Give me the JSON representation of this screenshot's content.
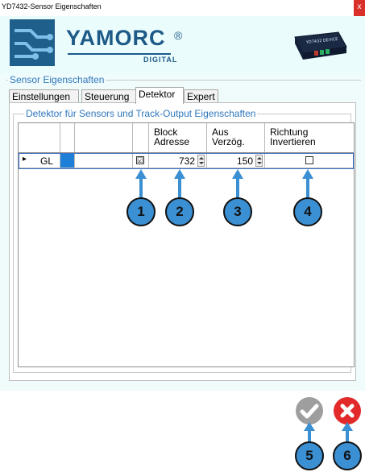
{
  "window": {
    "title": "YD7432-Sensor Eigenschaften",
    "close_glyph": "x"
  },
  "brand": {
    "name": "YAMORC",
    "registered": "®",
    "subtitle": "DIGITAL",
    "device_label": "YD7432 DEVICE"
  },
  "section": {
    "label": "Sensor Eigenschaften"
  },
  "tabs": [
    {
      "label": "Einstellungen",
      "active": false
    },
    {
      "label": "Steuerung",
      "active": false
    },
    {
      "label": "Detektor",
      "active": true
    },
    {
      "label": "Expert",
      "active": false
    }
  ],
  "group": {
    "label": "Detektor für Sensors und Track-Output Eigenschaften"
  },
  "grid": {
    "columns": [
      {
        "line1": "",
        "line2": ""
      },
      {
        "line1": "",
        "line2": ""
      },
      {
        "line1": "",
        "line2": ""
      },
      {
        "line1": "",
        "line2": ""
      },
      {
        "line1": "Block",
        "line2": "Adresse"
      },
      {
        "line1": "Aus",
        "line2": "Verzög."
      },
      {
        "line1": "Richtung",
        "line2": "Invertieren"
      }
    ],
    "rows": [
      {
        "indicator": "▸",
        "name": "GL",
        "color": "#1e7fd8",
        "enabled": true,
        "enabled_glyph": "☑",
        "block_adresse": "732",
        "aus_verzoeg": "150",
        "richtung_invertieren": false
      }
    ]
  },
  "markers": [
    "1",
    "2",
    "3",
    "4",
    "5",
    "6"
  ],
  "buttons": {
    "ok_glyph": "✔",
    "cancel_glyph": "✖"
  },
  "colors": {
    "accent": "#2e77bc",
    "marker": "#3b8fd3",
    "cancel": "#e32a2a",
    "ok": "#9e9e9e",
    "row_color": "#1e7fd8"
  }
}
